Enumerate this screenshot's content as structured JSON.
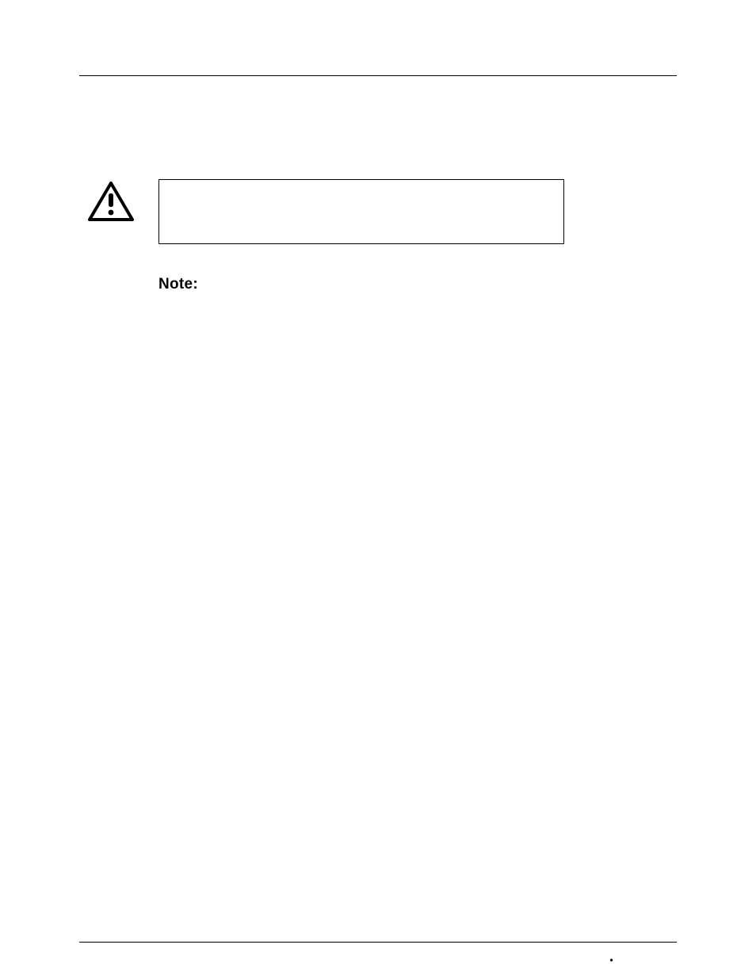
{
  "note": {
    "label": "Note:"
  },
  "footer": {
    "bullet": "•"
  }
}
